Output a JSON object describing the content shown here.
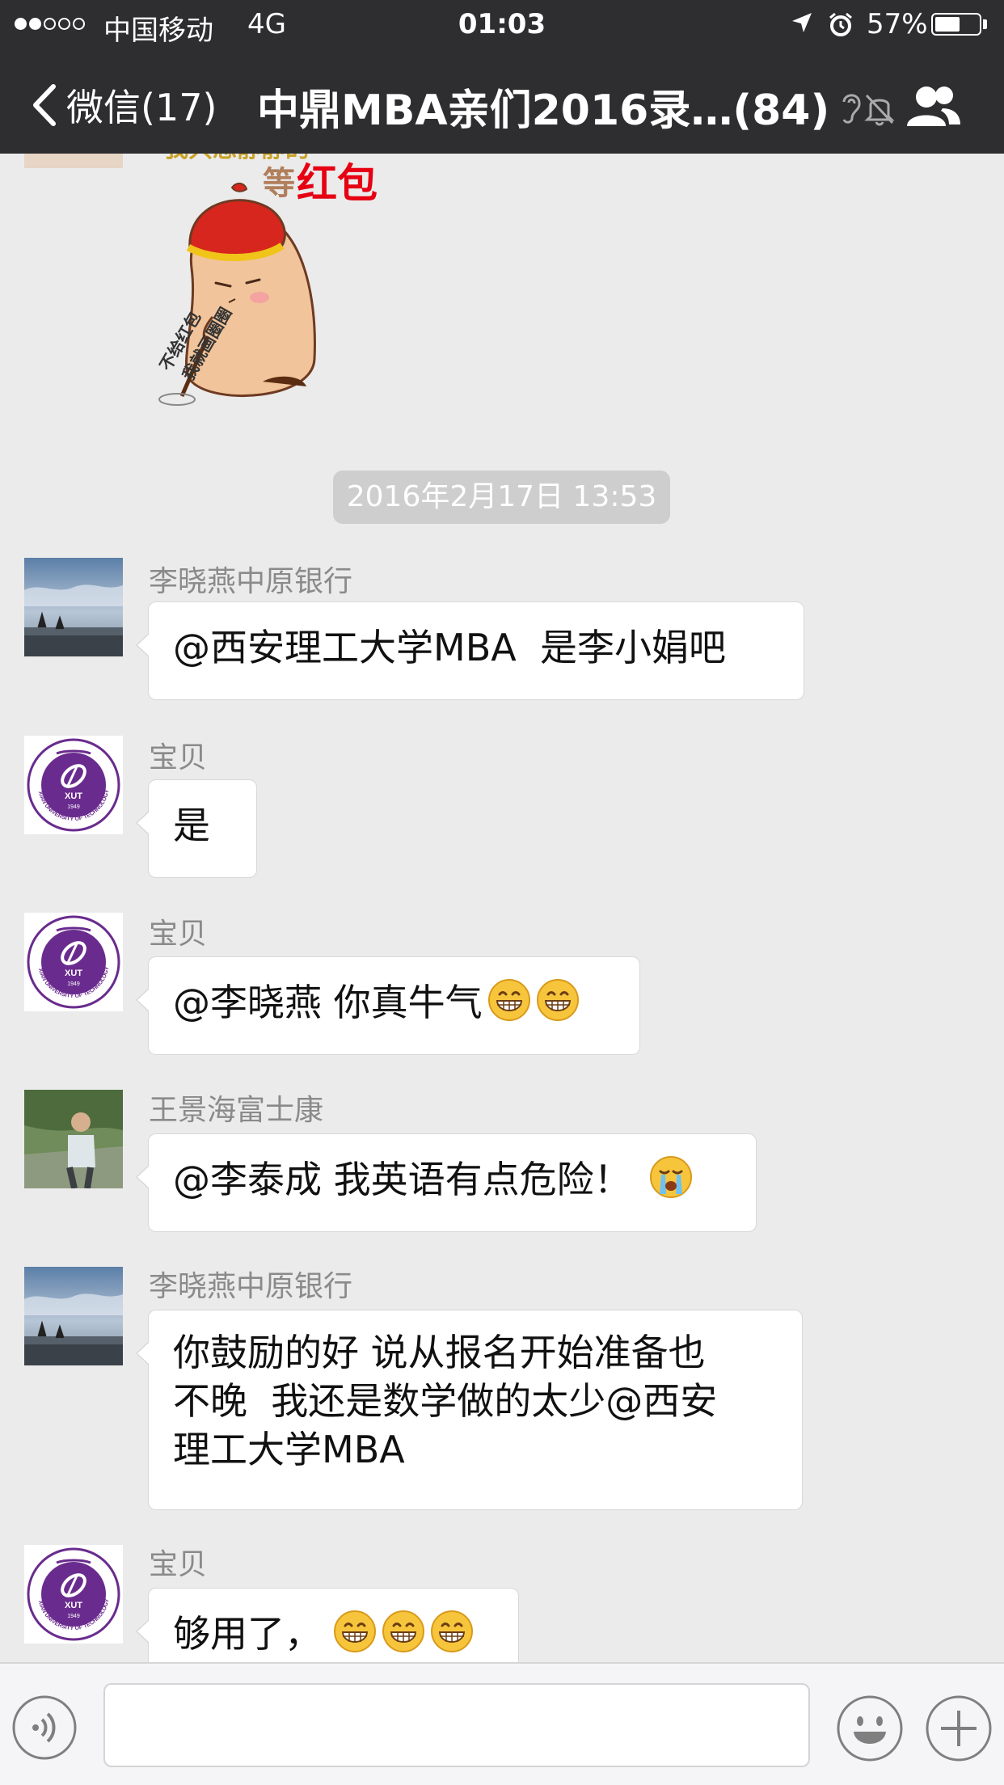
{
  "status_bar": {
    "carrier": "中国移动",
    "network": "4G",
    "time": "01:03",
    "battery_percent_text": "57%",
    "battery_level": 0.57,
    "signal_bars_filled": 2,
    "signal_bars_total": 5
  },
  "nav": {
    "back_label": "微信(17)",
    "title": "中鼎MBA亲们2016录…(84)"
  },
  "sticker": {
    "top_text": "我只想静静的",
    "main_text_a": "等",
    "main_text_b": "红包",
    "side_text_1": "不给红包",
    "side_text_2": "我就画圈圈"
  },
  "timestamp": "2016年2月17日 13:53",
  "avatars": {
    "sky": "sky-avatar-icon",
    "xut": "xut-logo-avatar-icon",
    "xut_ring_text": "XIAN UNIVERSITY OF TECHNOLOGY",
    "xut_abbr": "XUT",
    "xut_year": "1949",
    "person": "person-photo-avatar-icon"
  },
  "messages": [
    {
      "sender": "李晓燕中原银行",
      "text": "@西安理工大学MBA  是李小娟吧",
      "avatar": "sky"
    },
    {
      "sender": "宝贝",
      "text": "是",
      "avatar": "xut"
    },
    {
      "sender": "宝贝",
      "text": "@李晓燕 你真牛气",
      "emojis": [
        "grin-emoji",
        "grin-emoji"
      ],
      "avatar": "xut"
    },
    {
      "sender": "王景海富士康",
      "text": "@李泰成 我英语有点危险！",
      "emojis": [
        "crying-emoji"
      ],
      "avatar": "person"
    },
    {
      "sender": "李晓燕中原银行",
      "text_lines": [
        "你鼓励的好 说从报名开始准备也",
        "不晚  我还是数学做的太少@西安",
        "理工大学MBA"
      ],
      "avatar": "sky"
    },
    {
      "sender": "宝贝",
      "text": "够用了，",
      "emojis": [
        "grin-emoji",
        "grin-emoji",
        "grin-emoji"
      ],
      "avatar": "xut"
    }
  ],
  "input_bar": {
    "placeholder": "",
    "icons": [
      "voice-icon",
      "emoji-icon",
      "plus-icon"
    ]
  },
  "colors": {
    "header": "#2e2e30",
    "chat_background": "#ebebeb",
    "bubble": "#ffffff",
    "timestamp_pill": "#cecece",
    "sender_text": "#8a8a8a",
    "xut_purple": "#6a2b8e"
  }
}
